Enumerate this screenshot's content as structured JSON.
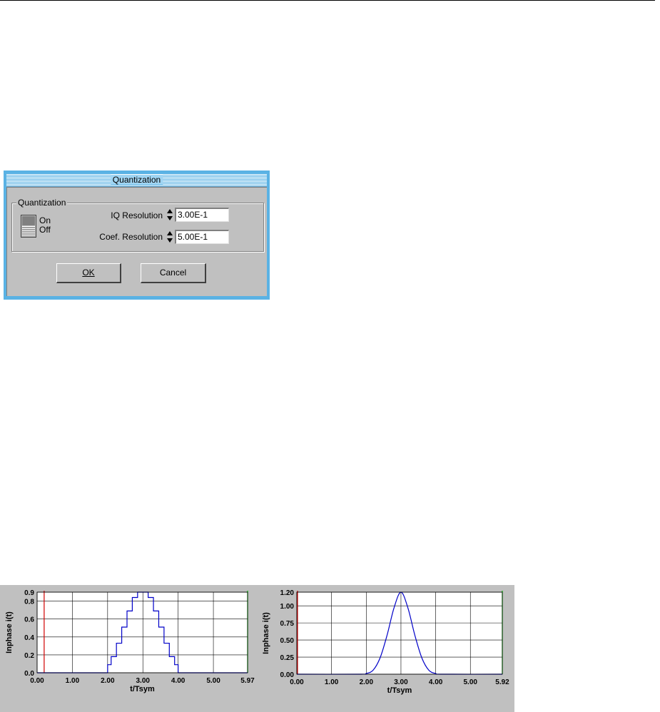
{
  "dialog": {
    "title": "Quantization",
    "group_label": "Quantization",
    "toggle": {
      "on_label": "On",
      "off_label": "Off",
      "state": "Off"
    },
    "iq_resolution": {
      "label": "IQ Resolution",
      "value": "3.00E-1"
    },
    "coef_resolution": {
      "label": "Coef. Resolution",
      "value": "5.00E-1"
    },
    "ok_label": "OK",
    "cancel_label": "Cancel"
  },
  "colors": {
    "titlebar": "#5ab2e4",
    "dialog_face": "#c0c0c0",
    "trace": "#0000c8",
    "left_cursor": "#d00000",
    "right_cursor": "#00c000"
  },
  "chart_data": [
    {
      "type": "line",
      "title": "",
      "xlabel": "t/Tsym",
      "ylabel": "Inphase i(t)",
      "xlim": [
        0,
        5.97
      ],
      "ylim": [
        0,
        0.9
      ],
      "x_ticks": [
        "0.00",
        "1.00",
        "2.00",
        "3.00",
        "4.00",
        "5.00",
        "5.97"
      ],
      "y_ticks": [
        "0.0",
        "0.2",
        "0.4",
        "0.6",
        "0.8",
        "0.9"
      ],
      "y_tick_values": [
        0,
        0.2,
        0.4,
        0.6,
        0.8,
        0.9
      ],
      "grid": true,
      "cursors": [
        0.2,
        5.97
      ],
      "series": [
        {
          "x": [
            0,
            2.0,
            2.0,
            2.1,
            2.1,
            2.25,
            2.25,
            2.4,
            2.4,
            2.55,
            2.55,
            2.7,
            2.7,
            2.85,
            2.85,
            3.15,
            3.15,
            3.3,
            3.3,
            3.45,
            3.45,
            3.6,
            3.6,
            3.75,
            3.75,
            3.9,
            3.9,
            4.0,
            4.0,
            5.97
          ],
          "y": [
            0,
            0,
            0.09,
            0.09,
            0.18,
            0.18,
            0.33,
            0.33,
            0.51,
            0.51,
            0.69,
            0.69,
            0.84,
            0.84,
            0.9,
            0.9,
            0.84,
            0.84,
            0.69,
            0.69,
            0.51,
            0.51,
            0.33,
            0.33,
            0.18,
            0.18,
            0.09,
            0.09,
            0,
            0
          ]
        }
      ]
    },
    {
      "type": "line",
      "title": "",
      "xlabel": "t/Tsym",
      "ylabel": "Inphase i(t)",
      "xlim": [
        0,
        5.92
      ],
      "ylim": [
        0,
        1.2
      ],
      "x_ticks": [
        "0.00",
        "1.00",
        "2.00",
        "3.00",
        "4.00",
        "5.00",
        "5.92"
      ],
      "y_ticks": [
        "0.00",
        "0.25",
        "0.50",
        "0.75",
        "1.00",
        "1.20"
      ],
      "y_tick_values": [
        0,
        0.25,
        0.5,
        0.75,
        1.0,
        1.2
      ],
      "grid": true,
      "cursors": [
        0.02,
        5.92
      ],
      "series": [
        {
          "x": [
            0,
            1.8,
            2.0,
            2.2,
            2.4,
            2.6,
            2.8,
            3.0,
            3.2,
            3.4,
            3.6,
            3.8,
            4.0,
            4.2,
            5.92
          ],
          "y": [
            0,
            0.0,
            0.01,
            0.06,
            0.24,
            0.57,
            0.97,
            1.2,
            0.97,
            0.57,
            0.24,
            0.06,
            0.01,
            0.0,
            0
          ]
        }
      ]
    }
  ]
}
